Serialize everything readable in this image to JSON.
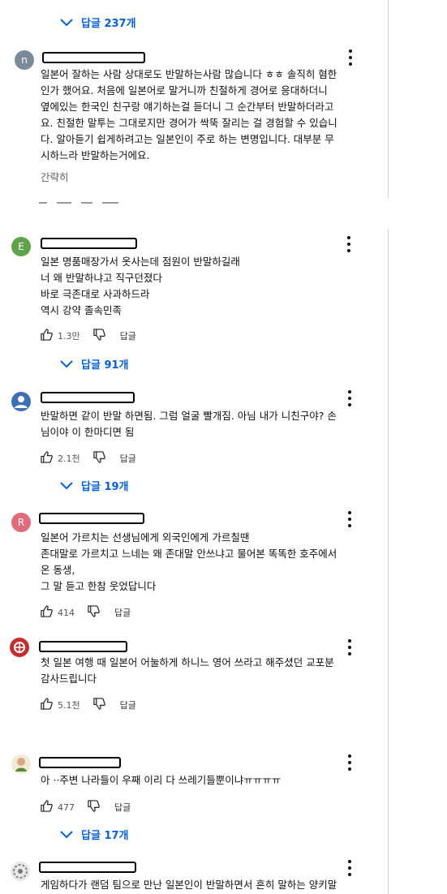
{
  "replies_label_prefix": "답글",
  "see_more": "간략히",
  "colors": {
    "link": "#065fd4",
    "icon": "#222222"
  },
  "top_replies": {
    "label": "답글 237개"
  },
  "comments": [
    {
      "avatar_letter": "n",
      "lines": [
        "일본어 잘하는 사람 상대로도 반말하는사람 많습니다 ㅎㅎ 솔직히 혐한",
        "인가 했어요. 처음에 일본어로 말거니까 친절하게 경어로 응대하더니",
        "옆에있는 한국인 친구랑 얘기하는걸 듣더니 그 순간부터 반말하더라고",
        "요. 친절한 말투는 그대로지만 경어가 싹뚝 잘리는 걸 경험할 수 있습니",
        "다. 알아듣기 쉽게하려고는 일본인이 주로 하는 변명입니다. 대부분 무",
        "시하느라 반말하는거에요."
      ]
    },
    {
      "avatar_letter": "E",
      "lines": [
        "일본 명품매장가서 옷사는데  점원이  반말하길래",
        "너 왜 반말하냐고  직구던졌다",
        "바로 극존대로  사과하드라",
        "역시 강약  졸속민족"
      ],
      "likes": "1.3만",
      "reply": "답글",
      "replies": "답글 91개"
    },
    {
      "lines": [
        "반말하면 같이 반말 하면됨. 그럼 얼굴 빨개짐. 아님 내가 니친구야? 손",
        "님이야 이 한마디면 됨"
      ],
      "likes": "2.1천",
      "reply": "답글",
      "replies": "답글 19개"
    },
    {
      "avatar_letter": "R",
      "lines": [
        "일본어 가르치는 선생님에게 외국인에게 가르칠땐",
        "존대말로 가르치고 느네는 왜 존대말 안쓰냐고 물어본 똑똑한 호주에서",
        "온 동생,",
        "그 말 듣고 한참 웃었답니다"
      ],
      "likes": "414",
      "reply": "답글"
    },
    {
      "lines": [
        "첫 일본 여행 때 일본어 어눌하게 하니느 영어 쓰라고 해주셨던 교포분",
        "감사드립니다"
      ],
      "likes": "5.1천",
      "reply": "답글"
    },
    {
      "lines": [
        "아 ··주변 나라들이 우째 이리 다 쓰레기들뿐이냐ㅠㅠㅠㅠ"
      ],
      "likes": "477",
      "reply": "답글",
      "replies": "답글 17개"
    },
    {
      "lines": [
        "게임하다가 랜덤 팀으로 만난 일본인이 반말하면서 흔히 말하는 양키말"
      ]
    }
  ]
}
